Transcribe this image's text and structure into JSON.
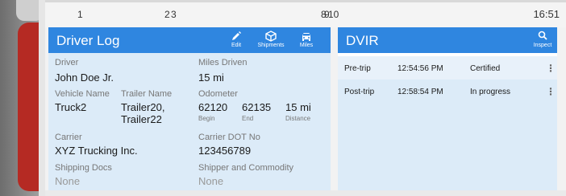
{
  "statusbar": {
    "items": [
      "1",
      "2",
      "3",
      "8",
      "9",
      "10"
    ],
    "clock": "16:51"
  },
  "driver_log": {
    "title": "Driver Log",
    "actions": [
      {
        "label": "Edit",
        "icon": "pencil-icon"
      },
      {
        "label": "Shipments",
        "icon": "package-icon"
      },
      {
        "label": "Miles",
        "icon": "car-icon"
      }
    ],
    "driver_label": "Driver",
    "driver_value": "John Doe Jr.",
    "miles_driven_label": "Miles Driven",
    "miles_driven_value": "15 mi",
    "vehicle_label": "Vehicle Name",
    "vehicle_value": "Truck2",
    "trailer_label": "Trailer Name",
    "trailer_value_1": "Trailer20,",
    "trailer_value_2": "Trailer22",
    "odometer_label": "Odometer",
    "odometer_begin": "62120",
    "odometer_end": "62135",
    "odometer_distance": "15 mi",
    "odometer_begin_label": "Begin",
    "odometer_end_label": "End",
    "odometer_distance_label": "Distance",
    "carrier_label": "Carrier",
    "carrier_value": "XYZ Trucking Inc.",
    "carrier_dot_label": "Carrier DOT No",
    "carrier_dot_value": "123456789",
    "shipping_docs_label": "Shipping Docs",
    "shipping_docs_value": "None",
    "shipper_label": "Shipper and Commodity",
    "shipper_value": "None"
  },
  "dvir": {
    "title": "DVIR",
    "inspect_label": "Inspect",
    "rows": [
      {
        "type": "Pre-trip",
        "time": "12:54:56 PM",
        "status": "Certified"
      },
      {
        "type": "Post-trip",
        "time": "12:58:54 PM",
        "status": "In progress"
      }
    ]
  },
  "colors": {
    "header_blue": "#2f86e0",
    "card_bg": "#dcebf8",
    "device_red": "#b52a23"
  }
}
